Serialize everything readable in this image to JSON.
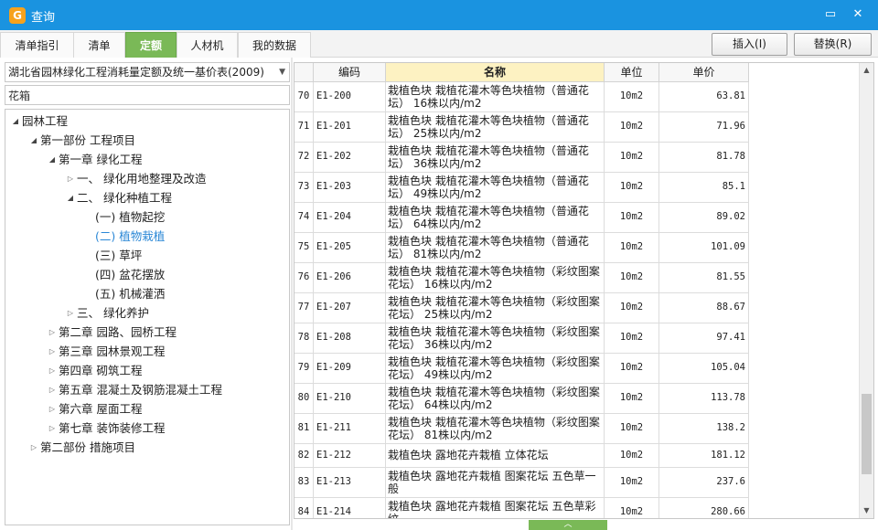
{
  "window": {
    "title": "查询",
    "app_icon": "G",
    "minimize_glyph": "▭",
    "close_glyph": "✕"
  },
  "tabs": [
    "清单指引",
    "清单",
    "定额",
    "人材机",
    "我的数据"
  ],
  "active_tab": "定额",
  "actions": {
    "insert_label": "插入(I)",
    "replace_label": "替换(R)"
  },
  "library": {
    "selected": "湖北省园林绿化工程消耗量定额及统一基价表(2009)"
  },
  "search": {
    "value": "花箱"
  },
  "tree": [
    {
      "label": "园林工程",
      "expanded": true
    },
    {
      "label": "第一部份 工程项目",
      "expanded": true
    },
    {
      "label": "第一章 绿化工程",
      "expanded": true
    },
    {
      "label": "一、 绿化用地整理及改造",
      "expanded": false
    },
    {
      "label": "二、 绿化种植工程",
      "expanded": true
    },
    {
      "label": "(一) 植物起挖"
    },
    {
      "label": "(二) 植物栽植",
      "selected": true
    },
    {
      "label": "(三) 草坪"
    },
    {
      "label": "(四) 盆花摆放"
    },
    {
      "label": "(五) 机械灌洒"
    },
    {
      "label": "三、 绿化养护",
      "expanded": false
    },
    {
      "label": "第二章 园路、园桥工程",
      "expanded": false
    },
    {
      "label": "第三章 园林景观工程",
      "expanded": false
    },
    {
      "label": "第四章 砌筑工程",
      "expanded": false
    },
    {
      "label": "第五章 混凝土及钢筋混凝土工程",
      "expanded": false
    },
    {
      "label": "第六章 屋面工程",
      "expanded": false
    },
    {
      "label": "第七章 装饰装修工程",
      "expanded": false
    },
    {
      "label": "第二部份 措施项目",
      "expanded": false
    }
  ],
  "grid": {
    "headers": {
      "seq": "",
      "code": "编码",
      "name": "名称",
      "unit": "单位",
      "price": "单价"
    },
    "sorted_column": "name",
    "rows": [
      {
        "seq": "70",
        "code": "E1-200",
        "name": "栽植色块 栽植花灌木等色块植物（普通花坛） 16株以内/m2",
        "unit": "10m2",
        "price": "63.81"
      },
      {
        "seq": "71",
        "code": "E1-201",
        "name": "栽植色块 栽植花灌木等色块植物（普通花坛） 25株以内/m2",
        "unit": "10m2",
        "price": "71.96"
      },
      {
        "seq": "72",
        "code": "E1-202",
        "name": "栽植色块 栽植花灌木等色块植物（普通花坛） 36株以内/m2",
        "unit": "10m2",
        "price": "81.78"
      },
      {
        "seq": "73",
        "code": "E1-203",
        "name": "栽植色块 栽植花灌木等色块植物（普通花坛） 49株以内/m2",
        "unit": "10m2",
        "price": "85.1"
      },
      {
        "seq": "74",
        "code": "E1-204",
        "name": "栽植色块 栽植花灌木等色块植物（普通花坛） 64株以内/m2",
        "unit": "10m2",
        "price": "89.02"
      },
      {
        "seq": "75",
        "code": "E1-205",
        "name": "栽植色块 栽植花灌木等色块植物（普通花坛） 81株以内/m2",
        "unit": "10m2",
        "price": "101.09"
      },
      {
        "seq": "76",
        "code": "E1-206",
        "name": "栽植色块 栽植花灌木等色块植物（彩纹图案花坛） 16株以内/m2",
        "unit": "10m2",
        "price": "81.55"
      },
      {
        "seq": "77",
        "code": "E1-207",
        "name": "栽植色块 栽植花灌木等色块植物（彩纹图案花坛） 25株以内/m2",
        "unit": "10m2",
        "price": "88.67"
      },
      {
        "seq": "78",
        "code": "E1-208",
        "name": "栽植色块 栽植花灌木等色块植物（彩纹图案花坛） 36株以内/m2",
        "unit": "10m2",
        "price": "97.41"
      },
      {
        "seq": "79",
        "code": "E1-209",
        "name": "栽植色块 栽植花灌木等色块植物（彩纹图案花坛） 49株以内/m2",
        "unit": "10m2",
        "price": "105.04"
      },
      {
        "seq": "80",
        "code": "E1-210",
        "name": "栽植色块 栽植花灌木等色块植物（彩纹图案花坛） 64株以内/m2",
        "unit": "10m2",
        "price": "113.78"
      },
      {
        "seq": "81",
        "code": "E1-211",
        "name": "栽植色块 栽植花灌木等色块植物（彩纹图案花坛） 81株以内/m2",
        "unit": "10m2",
        "price": "138.2"
      },
      {
        "seq": "82",
        "code": "E1-212",
        "name": "栽植色块 露地花卉栽植 立体花坛",
        "unit": "10m2",
        "price": "181.12"
      },
      {
        "seq": "83",
        "code": "E1-213",
        "name": "栽植色块 露地花卉栽植 图案花坛 五色草一般",
        "unit": "10m2",
        "price": "237.6"
      },
      {
        "seq": "84",
        "code": "E1-214",
        "name": "栽植色块 露地花卉栽植 图案花坛 五色草彩纹",
        "unit": "10m2",
        "price": "280.66"
      }
    ]
  },
  "colors": {
    "titlebar": "#1a93e0",
    "active_tab": "#7ab957",
    "sorted_header": "#fdf2c2",
    "selected_node": "#2a87d6"
  }
}
